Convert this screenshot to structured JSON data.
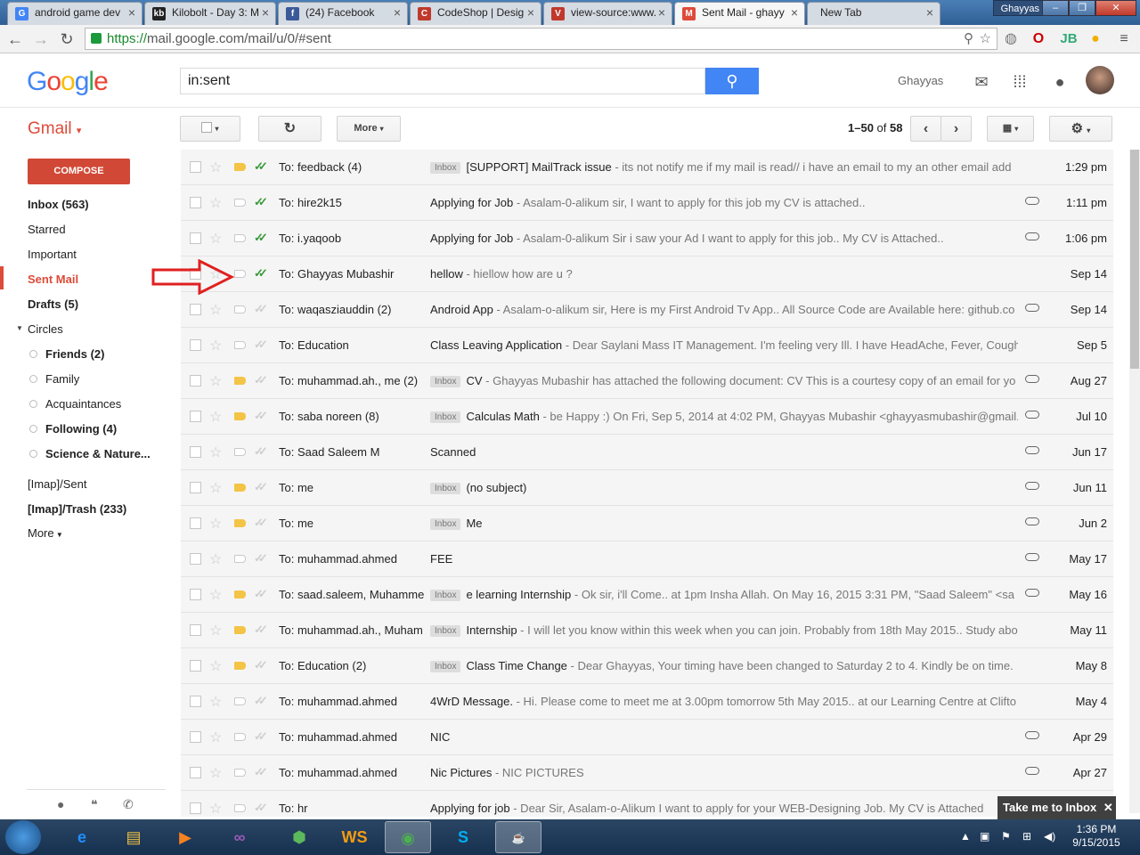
{
  "browser": {
    "tabs": [
      {
        "title": "android game dev",
        "favicon": "G",
        "color": "#4285f4"
      },
      {
        "title": "Kilobolt - Day 3: M",
        "favicon": "kb",
        "color": "#222"
      },
      {
        "title": "(24) Facebook",
        "favicon": "f",
        "color": "#3b5998"
      },
      {
        "title": "CodeShop | Desig",
        "favicon": "C",
        "color": "#c0392b"
      },
      {
        "title": "view-source:www.",
        "favicon": "V",
        "color": "#c0392b"
      },
      {
        "title": "Sent Mail - ghayy",
        "favicon": "M",
        "color": "#dd4b39"
      },
      {
        "title": "New Tab",
        "favicon": "",
        "color": "#999"
      }
    ],
    "user_badge": "Ghayyas",
    "url_https": "https://",
    "url_rest": "mail.google.com/mail/u/0/#sent"
  },
  "header": {
    "search_value": "in:sent",
    "username": "Ghayyas"
  },
  "toolbar": {
    "gmail_label": "Gmail",
    "more_label": "More",
    "page_range": "1–50",
    "page_of": "of",
    "page_total": "58"
  },
  "sidebar": {
    "compose": "COMPOSE",
    "inbox": "Inbox (563)",
    "starred": "Starred",
    "important": "Important",
    "sent": "Sent Mail",
    "drafts": "Drafts (5)",
    "circles": "Circles",
    "friends": "Friends (2)",
    "family": "Family",
    "acquaintances": "Acquaintances",
    "following": "Following (4)",
    "science": "Science & Nature...",
    "imap_sent": "[Imap]/Sent",
    "imap_trash": "[Imap]/Trash (233)",
    "more": "More"
  },
  "messages": [
    {
      "to": "To: feedback (4)",
      "inbox": true,
      "subject": "[SUPPORT] MailTrack issue",
      "snippet": " - its not notify me if my mail is read// i have an email to my an other email add",
      "date": "1:29 pm",
      "attach": false,
      "tick": "green",
      "tag": "imp"
    },
    {
      "to": "To: hire2k15",
      "inbox": false,
      "subject": "Applying for Job",
      "snippet": " - Asalam-0-alikum sir, I want to apply for this job my CV is attached..",
      "date": "1:11 pm",
      "attach": true,
      "tick": "green",
      "tag": "no"
    },
    {
      "to": "To: i.yaqoob",
      "inbox": false,
      "subject": "Applying for Job",
      "snippet": " - Asalam-0-alikum Sir i saw your Ad I want to apply for this job.. My CV is Attached..",
      "date": "1:06 pm",
      "attach": true,
      "tick": "green",
      "tag": "no"
    },
    {
      "to": "To: Ghayyas Mubashir",
      "inbox": false,
      "subject": "hellow",
      "snippet": " - hiellow how are u ?",
      "date": "Sep 14",
      "attach": false,
      "tick": "green",
      "tag": "no"
    },
    {
      "to": "To: waqasziauddin (2)",
      "inbox": false,
      "subject": "Android App",
      "snippet": " - Asalam-o-alikum sir, Here is my First Android Tv App.. All Source Code are Available here: github.co",
      "date": "Sep 14",
      "attach": true,
      "tick": "none",
      "tag": "no"
    },
    {
      "to": "To: Education",
      "inbox": false,
      "subject": "Class Leaving Application",
      "snippet": " - Dear Saylani Mass IT Management. I'm feeling very Ill. I have HeadAche, Fever, Cough",
      "date": "Sep 5",
      "attach": false,
      "tick": "none",
      "tag": "no"
    },
    {
      "to": "To: muhammad.ah., me (2)",
      "inbox": true,
      "subject": "CV",
      "snippet": " - Ghayyas Mubashir has attached the following document: CV This is a courtesy copy of an email for yo",
      "date": "Aug 27",
      "attach": true,
      "tick": "none",
      "tag": "imp"
    },
    {
      "to": "To: saba noreen (8)",
      "inbox": true,
      "subject": "Calculas Math",
      "snippet": " - be Happy :) On Fri, Sep 5, 2014 at 4:02 PM, Ghayyas Mubashir <ghayyasmubashir@gmail.",
      "date": "Jul 10",
      "attach": true,
      "tick": "none",
      "tag": "imp"
    },
    {
      "to": "To: Saad Saleem M",
      "inbox": false,
      "subject": "Scanned",
      "snippet": "",
      "date": "Jun 17",
      "attach": true,
      "tick": "none",
      "tag": "no"
    },
    {
      "to": "To: me",
      "inbox": true,
      "subject": "(no subject)",
      "snippet": "",
      "date": "Jun 11",
      "attach": true,
      "tick": "none",
      "tag": "imp"
    },
    {
      "to": "To: me",
      "inbox": true,
      "subject": "Me",
      "snippet": "",
      "date": "Jun 2",
      "attach": true,
      "tick": "none",
      "tag": "imp"
    },
    {
      "to": "To: muhammad.ahmed",
      "inbox": false,
      "subject": "FEE",
      "snippet": "",
      "date": "May 17",
      "attach": true,
      "tick": "none",
      "tag": "no"
    },
    {
      "to": "To: saad.saleem, Muhamme",
      "inbox": true,
      "subject": "e learning Internship",
      "snippet": " - Ok sir, i'll Come.. at 1pm Insha Allah. On May 16, 2015 3:31 PM, \"Saad Saleem\" <sa",
      "date": "May 16",
      "attach": true,
      "tick": "none",
      "tag": "imp"
    },
    {
      "to": "To: muhammad.ah., Muham",
      "inbox": true,
      "subject": "Internship",
      "snippet": " - I will let you know within this week when you can join. Probably from 18th May 2015.. Study abo",
      "date": "May 11",
      "attach": false,
      "tick": "none",
      "tag": "imp"
    },
    {
      "to": "To: Education (2)",
      "inbox": true,
      "subject": "Class Time Change",
      "snippet": " - Dear Ghayyas, Your timing have been changed to Saturday 2 to 4. Kindly be on time.",
      "date": "May 8",
      "attach": false,
      "tick": "none",
      "tag": "imp"
    },
    {
      "to": "To: muhammad.ahmed",
      "inbox": false,
      "subject": "4WrD Message.",
      "snippet": " - Hi. Please come to meet me at 3.00pm tomorrow 5th May 2015.. at our Learning Centre at Clifto",
      "date": "May 4",
      "attach": false,
      "tick": "none",
      "tag": "no"
    },
    {
      "to": "To: muhammad.ahmed",
      "inbox": false,
      "subject": "NIC",
      "snippet": "",
      "date": "Apr 29",
      "attach": true,
      "tick": "none",
      "tag": "no"
    },
    {
      "to": "To: muhammad.ahmed",
      "inbox": false,
      "subject": "Nic Pictures",
      "snippet": " - NIC PICTURES",
      "date": "Apr 27",
      "attach": true,
      "tick": "none",
      "tag": "no"
    },
    {
      "to": "To: hr",
      "inbox": false,
      "subject": "Applying for job",
      "snippet": " - Dear Sir, Asalam-o-Alikum I want to apply for your WEB-Designing Job. My CV is Attached",
      "date": "",
      "attach": false,
      "tick": "none",
      "tag": "no"
    }
  ],
  "take_me": "Take me to Inbox",
  "taskbar": {
    "time": "1:36 PM",
    "date": "9/15/2015"
  }
}
